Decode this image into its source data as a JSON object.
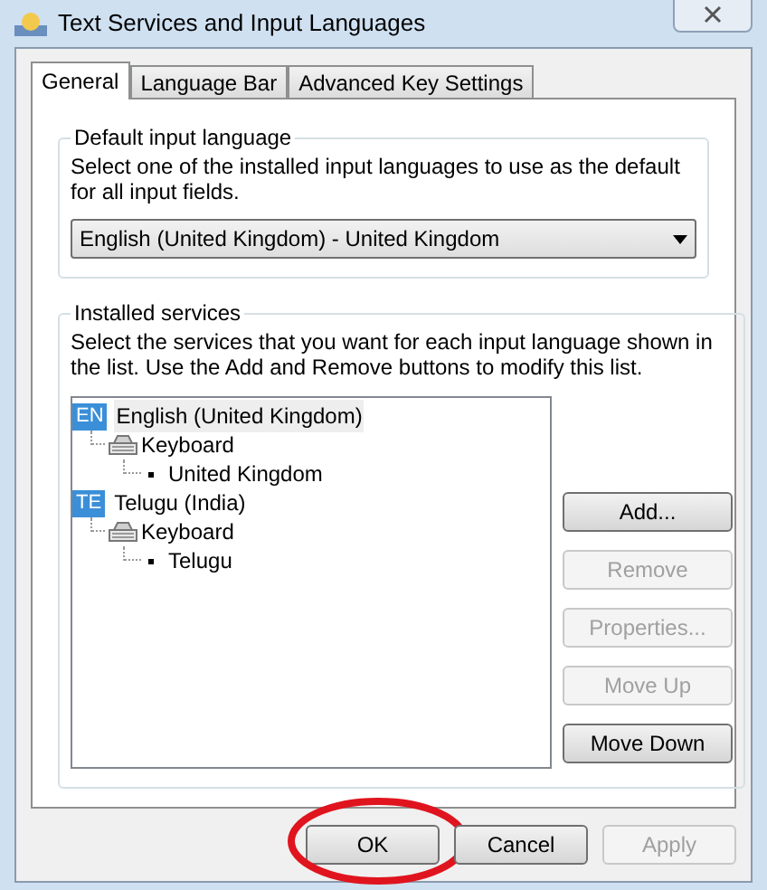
{
  "window": {
    "title": "Text Services and Input Languages"
  },
  "tabs": [
    {
      "label": "General",
      "selected": true
    },
    {
      "label": "Language Bar",
      "selected": false
    },
    {
      "label": "Advanced Key Settings",
      "selected": false
    }
  ],
  "default_input_language": {
    "heading": "Default input language",
    "description": "Select one of the installed input languages to use as the default for all input fields.",
    "value": "English (United Kingdom) - United Kingdom"
  },
  "installed_services": {
    "heading": "Installed services",
    "description": "Select the services that you want for each input language shown in the list. Use the Add and Remove buttons to modify this list.",
    "tree": [
      {
        "badge": "EN",
        "label": "English (United Kingdom)",
        "selected": true,
        "children": [
          {
            "label": "Keyboard",
            "children": [
              {
                "label": "United Kingdom"
              }
            ]
          }
        ]
      },
      {
        "badge": "TE",
        "label": "Telugu (India)",
        "selected": false,
        "children": [
          {
            "label": "Keyboard",
            "children": [
              {
                "label": "Telugu"
              }
            ]
          }
        ]
      }
    ],
    "buttons": [
      {
        "label": "Add...",
        "disabled": false
      },
      {
        "label": "Remove",
        "disabled": true
      },
      {
        "label": "Properties...",
        "disabled": true
      },
      {
        "label": "Move Up",
        "disabled": true
      },
      {
        "label": "Move Down",
        "disabled": false
      }
    ]
  },
  "footer_buttons": [
    {
      "label": "OK",
      "disabled": false,
      "circled": true
    },
    {
      "label": "Cancel",
      "disabled": false,
      "circled": false
    },
    {
      "label": "Apply",
      "disabled": true,
      "circled": false
    }
  ]
}
